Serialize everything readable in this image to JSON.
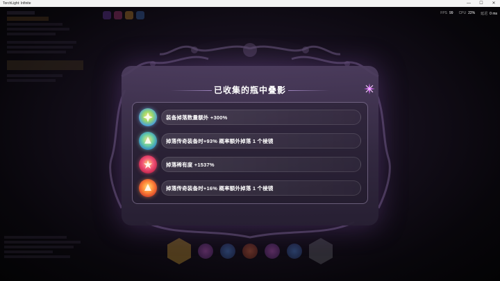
{
  "window": {
    "title": "TorchLight: Infinite",
    "minimize": "—",
    "maximize": "☐",
    "close": "✕"
  },
  "perf": {
    "fps_label": "FPS",
    "fps_value": "99",
    "cpu_label": "CPU",
    "cpu_value": "22%",
    "latency_label": "延迟",
    "latency_value": "0 ms"
  },
  "modal": {
    "title": "已收集的瓶中叠影",
    "items": [
      {
        "text": "装备掉落数量额外 +300%",
        "icon": "gear-drop-icon"
      },
      {
        "text": "掉落传奇装备时+93% 概率额外掉落 1 个棱镜",
        "icon": "prism-icon"
      },
      {
        "text": "掉落稀有度 +1537%",
        "icon": "rarity-icon"
      },
      {
        "text": "掉落传奇装备时+16% 概率额外掉落 1 个棱镜",
        "icon": "prism-orange-icon"
      }
    ]
  },
  "colors": {
    "accent": "#b98ae0",
    "close_star": "#d56cf2"
  }
}
